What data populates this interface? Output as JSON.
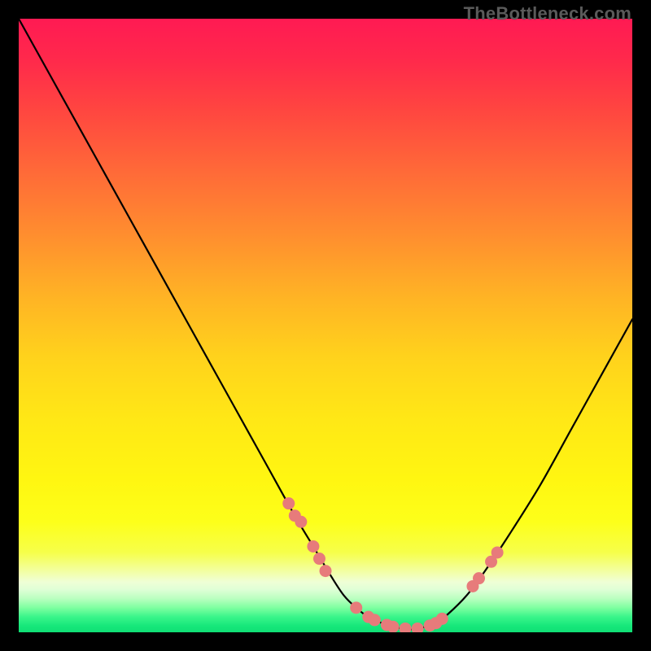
{
  "watermark": "TheBottleneck.com",
  "chart_data": {
    "type": "line",
    "title": "",
    "xlabel": "",
    "ylabel": "",
    "xlim": [
      0,
      100
    ],
    "ylim": [
      0,
      100
    ],
    "series": [
      {
        "name": "bottleneck-curve",
        "x": [
          0,
          5,
          10,
          15,
          20,
          25,
          30,
          35,
          40,
          45,
          48,
          51,
          53,
          55,
          57,
          60,
          62,
          64,
          66,
          68,
          70,
          73,
          76,
          80,
          85,
          90,
          95,
          100
        ],
        "y": [
          100,
          91,
          82,
          73,
          64,
          55,
          46,
          37,
          28,
          19,
          14,
          9,
          6,
          4,
          2.5,
          1.2,
          0.7,
          0.5,
          0.8,
          1.5,
          3,
          6,
          10,
          16,
          24,
          33,
          42,
          51
        ]
      }
    ],
    "markers": {
      "name": "highlight-dots",
      "color": "#e77b7b",
      "points": [
        {
          "x": 44,
          "y": 21
        },
        {
          "x": 45,
          "y": 19
        },
        {
          "x": 46,
          "y": 18
        },
        {
          "x": 48,
          "y": 14
        },
        {
          "x": 49,
          "y": 12
        },
        {
          "x": 50,
          "y": 10
        },
        {
          "x": 55,
          "y": 4
        },
        {
          "x": 57,
          "y": 2.5
        },
        {
          "x": 58,
          "y": 2
        },
        {
          "x": 60,
          "y": 1.2
        },
        {
          "x": 61,
          "y": 0.9
        },
        {
          "x": 63,
          "y": 0.6
        },
        {
          "x": 65,
          "y": 0.6
        },
        {
          "x": 67,
          "y": 1.1
        },
        {
          "x": 68,
          "y": 1.5
        },
        {
          "x": 69,
          "y": 2.2
        },
        {
          "x": 74,
          "y": 7.5
        },
        {
          "x": 75,
          "y": 8.8
        },
        {
          "x": 77,
          "y": 11.5
        },
        {
          "x": 78,
          "y": 13
        }
      ]
    },
    "gradient_stops": [
      {
        "offset": 0.0,
        "color": "#ff1a53"
      },
      {
        "offset": 0.07,
        "color": "#ff2a4b"
      },
      {
        "offset": 0.15,
        "color": "#ff4640"
      },
      {
        "offset": 0.25,
        "color": "#ff6a38"
      },
      {
        "offset": 0.35,
        "color": "#ff8d2f"
      },
      {
        "offset": 0.45,
        "color": "#ffb225"
      },
      {
        "offset": 0.55,
        "color": "#ffd21c"
      },
      {
        "offset": 0.65,
        "color": "#ffe716"
      },
      {
        "offset": 0.75,
        "color": "#fff611"
      },
      {
        "offset": 0.82,
        "color": "#fdff1a"
      },
      {
        "offset": 0.87,
        "color": "#f6ff4a"
      },
      {
        "offset": 0.905,
        "color": "#f2ffb0"
      },
      {
        "offset": 0.918,
        "color": "#efffd6"
      },
      {
        "offset": 0.93,
        "color": "#e0ffd6"
      },
      {
        "offset": 0.945,
        "color": "#baffc0"
      },
      {
        "offset": 0.96,
        "color": "#7effa0"
      },
      {
        "offset": 0.975,
        "color": "#39f58a"
      },
      {
        "offset": 0.99,
        "color": "#16e77a"
      },
      {
        "offset": 1.0,
        "color": "#10df75"
      }
    ]
  }
}
